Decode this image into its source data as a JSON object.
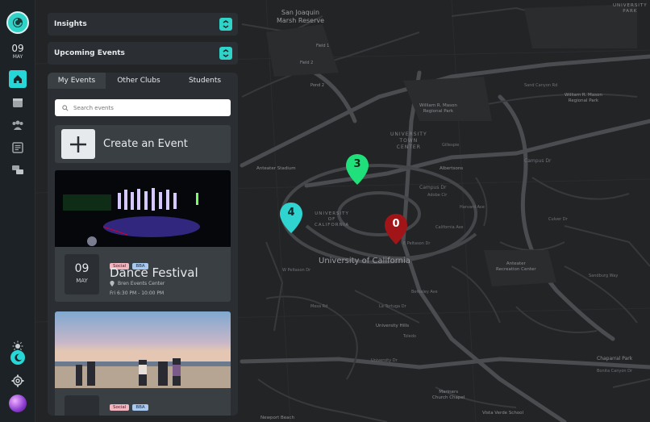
{
  "colors": {
    "accent": "#2fd3c8",
    "home_active": "#27d7d7",
    "pin_green": "#1fe07a",
    "pin_cyan": "#2fd3d0",
    "pin_red": "#a11518",
    "tag_pink": "#f2b6c0",
    "tag_blue": "#a9c9ef"
  },
  "sidebar": {
    "date_day": "09",
    "date_month": "MAY",
    "icons": [
      "logo-icon",
      "home-icon",
      "calendar-icon",
      "users-icon",
      "news-icon",
      "chat-icon",
      "sun-icon",
      "moon-icon",
      "gear-icon",
      "avatar"
    ]
  },
  "accordions": [
    {
      "label": "Insights"
    },
    {
      "label": "Upcoming Events"
    }
  ],
  "tabs": [
    {
      "label": "My Events",
      "active": true
    },
    {
      "label": "Other Clubs",
      "active": false
    },
    {
      "label": "Students",
      "active": false
    }
  ],
  "search": {
    "placeholder": "Search events"
  },
  "create_event": {
    "label": "Create an Event"
  },
  "events": [
    {
      "day": "09",
      "month": "MAY",
      "tags": [
        "Social",
        "BBA"
      ],
      "title": "Dance Festival",
      "location": "Bren Events Center",
      "time": "Fri 6:30 PM - 10:00 PM"
    },
    {
      "day": "",
      "month": "",
      "tags": [
        "Social",
        "BBA"
      ],
      "title": "",
      "location": "",
      "time": ""
    }
  ],
  "map": {
    "labels": {
      "san_joaquin": "San Joaquin\nMarsh Reserve",
      "university_center": "UNIVERSITY\nTOWN\nCENTER",
      "university_california": "UNIVERSITY\nOF\nCALIFORNIA",
      "uc_big": "University of California",
      "mason_park": "William R. Mason\nRegional Park",
      "mason_park2": "William R. Mason\nRegional Park",
      "anteater_stadium": "Anteater Stadium",
      "anteater_rec": "Anteater\nRecreation Center",
      "albertsons": "Albertsons",
      "university_hills": "University Hills",
      "mariners_chapel": "Mariners\nChurch Chapel",
      "vista_verde": "Vista Verde School",
      "chaparral": "Chaparral Park",
      "newport": "Newport Beach",
      "university_park": "UNIVERSITY\nPARK",
      "field_2": "Field 2",
      "field_1": "Field 1",
      "pond_2": "Pond 2",
      "sand_canyon": "Sand Canyon Rd",
      "campus_dr_1": "Campus Dr",
      "campus_dr_2": "Campus Dr",
      "bonita_canyon": "Bonita Canyon Dr",
      "university_dr": "University Dr",
      "e_peltason": "E Peltason Dr",
      "w_peltason": "W Peltason Dr",
      "culver_dr": "Culver Dr",
      "california_ave": "California Ave",
      "harvard_ave": "Harvard Ave",
      "gillespie": "Gillespie",
      "la_tortuga": "La Tortuga Dr",
      "adobe_cir": "Adobe Cir",
      "toledo": "Toledo",
      "berkeley": "Berkeley Ave",
      "sb_road": "Sandburg Way",
      "mesa_rd": "Mesa Rd"
    },
    "pins": [
      {
        "count": "3",
        "color": "green"
      },
      {
        "count": "4",
        "color": "cyan"
      },
      {
        "count": "0",
        "color": "red"
      }
    ]
  }
}
